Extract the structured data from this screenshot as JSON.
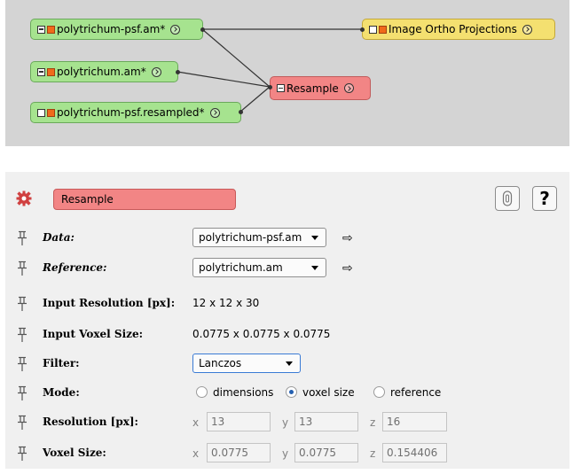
{
  "graph": {
    "nodes": {
      "psf": {
        "label": "polytrichum-psf.am*"
      },
      "poly": {
        "label": "polytrichum.am*"
      },
      "resampled": {
        "label": "polytrichum-psf.resampled*"
      },
      "resample": {
        "label": "Resample"
      },
      "ortho": {
        "label": "Image Ortho Projections"
      }
    },
    "colors": {
      "background": "#d4d4d4",
      "data_node": "#a6e38f",
      "module_node": "#f4e070",
      "compute_node": "#f28585"
    }
  },
  "properties": {
    "title": "Resample",
    "help_label": "?",
    "rows": {
      "data": {
        "label": "Data:",
        "value": "polytrichum-psf.am"
      },
      "reference": {
        "label": "Reference:",
        "value": "polytrichum.am"
      },
      "input_resolution": {
        "label": "Input Resolution [px]:",
        "value": "12 x 12 x 30"
      },
      "input_voxel": {
        "label": "Input Voxel Size:",
        "value": "0.0775 x 0.0775 x 0.0775"
      },
      "filter": {
        "label": "Filter:",
        "value": "Lanczos"
      },
      "mode": {
        "label": "Mode:",
        "options": [
          "dimensions",
          "voxel size",
          "reference"
        ],
        "selected": "voxel size"
      },
      "resolution": {
        "label": "Resolution [px]:",
        "x": "13",
        "y": "13",
        "z": "16"
      },
      "voxel_size": {
        "label": "Voxel Size:",
        "x": "0.0775",
        "y": "0.0775",
        "z": "0.154406"
      }
    },
    "axis_labels": {
      "x": "x",
      "y": "y",
      "z": "z"
    }
  }
}
